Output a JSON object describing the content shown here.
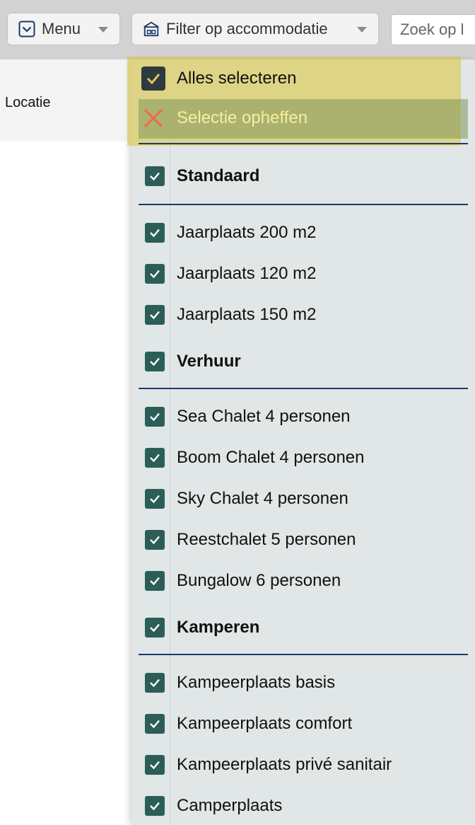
{
  "toolbar": {
    "menu_label": "Menu",
    "filter_label": "Filter op accommodatie",
    "search_placeholder": "Zoek op l"
  },
  "table": {
    "location_header": "Locatie"
  },
  "dropdown": {
    "select_all_label": "Alles selecteren",
    "clear_selection_label": "Selectie opheffen",
    "groups": [
      {
        "label": "Standaard",
        "checked": true
      },
      {
        "label": "Jaarplaats 200 m2",
        "checked": true
      },
      {
        "label": "Jaarplaats 120 m2",
        "checked": true
      },
      {
        "label": "Jaarplaats 150 m2",
        "checked": true
      },
      {
        "label": "Verhuur",
        "checked": true
      },
      {
        "label": "Sea Chalet 4 personen",
        "checked": true
      },
      {
        "label": "Boom Chalet 4 personen",
        "checked": true
      },
      {
        "label": "Sky Chalet 4 personen",
        "checked": true
      },
      {
        "label": "Reestchalet 5 personen",
        "checked": true
      },
      {
        "label": "Bungalow 6 personen",
        "checked": true
      },
      {
        "label": "Kamperen",
        "checked": true
      },
      {
        "label": "Kampeerplaats basis",
        "checked": true
      },
      {
        "label": "Kampeerplaats comfort",
        "checked": true
      },
      {
        "label": "Kampeerplaats privé sanitair",
        "checked": true
      },
      {
        "label": "Camperplaats",
        "checked": true
      }
    ]
  },
  "colors": {
    "checkbox": "#2b5e56",
    "separator": "#1f3a68",
    "clear_icon": "#e8704a",
    "highlight": "#dbc846"
  },
  "icons": {
    "menu": "chevron-down-square-icon",
    "filter": "building-icon",
    "clear": "close-icon",
    "check": "check-icon"
  }
}
